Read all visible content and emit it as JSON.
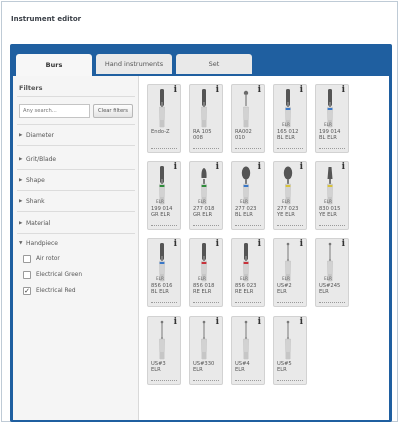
{
  "window": {
    "title": "Instrument editor"
  },
  "tabs": [
    {
      "label": "Burs",
      "active": true
    },
    {
      "label": "Hand instruments",
      "active": false
    },
    {
      "label": "Set",
      "active": false
    }
  ],
  "filters": {
    "heading": "Filters",
    "search_placeholder": "Any search...",
    "clear_label": "Clear filters",
    "categories": [
      {
        "label": "Diameter",
        "expanded": false
      },
      {
        "label": "Grit/Blade",
        "expanded": false
      },
      {
        "label": "Shape",
        "expanded": false
      },
      {
        "label": "Shank",
        "expanded": false
      },
      {
        "label": "Material",
        "expanded": false
      },
      {
        "label": "Handpiece",
        "expanded": true
      }
    ],
    "handpiece_options": [
      {
        "label": "Air rotor",
        "checked": false
      },
      {
        "label": "Electrical Green",
        "checked": false
      },
      {
        "label": "Electrical Red",
        "checked": true
      }
    ]
  },
  "instruments": [
    {
      "label": "Endo-Z",
      "marking": "",
      "band": "",
      "shape": "cyl"
    },
    {
      "label": "RA 105\n008",
      "marking": "",
      "band": "",
      "shape": "cyl"
    },
    {
      "label": "RA002\n010",
      "marking": "",
      "band": "",
      "shape": "ball"
    },
    {
      "label": "165 012\nBL ELR",
      "marking": "ELR",
      "band": "#3a78c8",
      "shape": "cyl"
    },
    {
      "label": "199 014\nBL ELR",
      "marking": "ELR",
      "band": "#3a78c8",
      "shape": "cyl"
    },
    {
      "label": "199 014\nGR ELR",
      "marking": "ELR",
      "band": "#2e8b3a",
      "shape": "cyl"
    },
    {
      "label": "277 018\nGR ELR",
      "marking": "ELR",
      "band": "#2e8b3a",
      "shape": "pear"
    },
    {
      "label": "277 023\nBL ELR",
      "marking": "ELR",
      "band": "#3a78c8",
      "shape": "oval"
    },
    {
      "label": "277 023\nYE ELR",
      "marking": "ELR",
      "band": "#d8c23a",
      "shape": "oval"
    },
    {
      "label": "830 015\nYE ELR",
      "marking": "ELR",
      "band": "#d8c23a",
      "shape": "cone"
    },
    {
      "label": "856 016\nBL ELR",
      "marking": "ELR",
      "band": "#3a78c8",
      "shape": "cyl"
    },
    {
      "label": "856 018\nRE ELR",
      "marking": "ELR",
      "band": "#c8323a",
      "shape": "cyl"
    },
    {
      "label": "856 023\nRE ELR",
      "marking": "ELR",
      "band": "#c8323a",
      "shape": "cyl"
    },
    {
      "label": "US#2\nELR",
      "marking": "ELR",
      "band": "",
      "shape": "tip"
    },
    {
      "label": "US#245\nELR",
      "marking": "ELR",
      "band": "",
      "shape": "tip"
    },
    {
      "label": "US#3\nELR",
      "marking": "",
      "band": "",
      "shape": "tip"
    },
    {
      "label": "US#330\nELR",
      "marking": "",
      "band": "",
      "shape": "tip"
    },
    {
      "label": "US#4\nELR",
      "marking": "",
      "band": "",
      "shape": "tip"
    },
    {
      "label": "US#5\nELR",
      "marking": "",
      "band": "",
      "shape": "tip"
    }
  ],
  "info_glyph": "i",
  "colors": {
    "accent": "#1f5fa0",
    "card_bg": "#e9e9e9"
  }
}
